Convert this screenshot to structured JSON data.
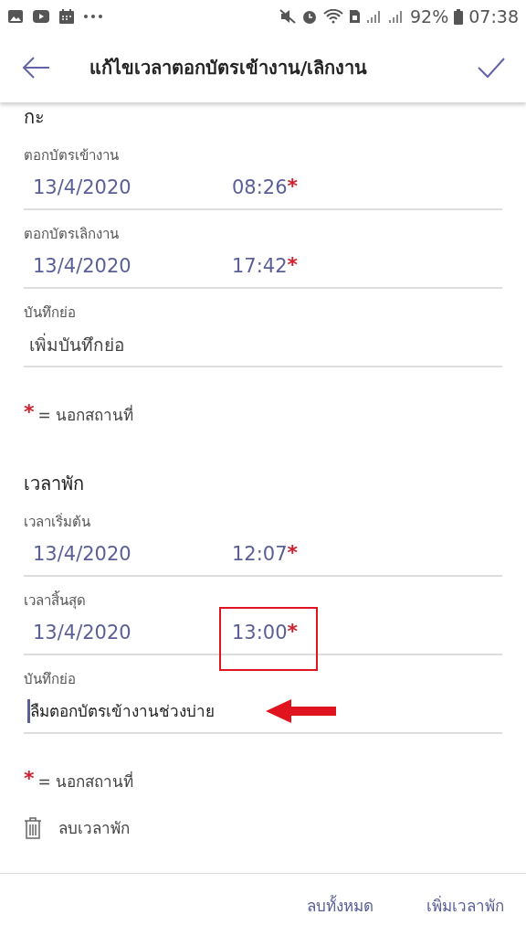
{
  "status_bar": {
    "battery": "92%",
    "time": "07:38"
  },
  "app_bar": {
    "title": "แก้ไขเวลาตอกบัตรเข้างาน/เลิกงาน"
  },
  "sections": [
    {
      "title": "กะ",
      "fields": [
        {
          "kind": "datetime",
          "label": "ตอกบัตรเข้างาน",
          "date": "13/4/2020",
          "time": "08:26",
          "marker": "*"
        },
        {
          "kind": "datetime",
          "label": "ตอกบัตรเลิกงาน",
          "date": "13/4/2020",
          "time": "17:42",
          "marker": "*"
        },
        {
          "kind": "note",
          "label": "บันทึกย่อ",
          "placeholder": "เพิ่มบันทึกย่อ"
        }
      ],
      "legend": {
        "marker": "*",
        "text": "= นอกสถานที่"
      }
    },
    {
      "title": "เวลาพัก",
      "fields": [
        {
          "kind": "datetime",
          "label": "เวลาเริ่มต้น",
          "date": "13/4/2020",
          "time": "12:07",
          "marker": "*"
        },
        {
          "kind": "datetime",
          "label": "เวลาสิ้นสุด",
          "date": "13/4/2020",
          "time": "13:00",
          "marker": "*",
          "highlighted": true
        },
        {
          "kind": "note",
          "label": "บันทึกย่อ",
          "value": "ลืมตอกบัตรเข้างานช่วงบ่าย",
          "focused": true,
          "arrow": true
        }
      ],
      "legend": {
        "marker": "*",
        "text": "= นอกสถานที่"
      },
      "delete_label": "ลบเวลาพัก"
    }
  ],
  "footer": {
    "buttons": [
      "ลบทั้งหมด",
      "เพิ่มเวลาพัก"
    ]
  }
}
